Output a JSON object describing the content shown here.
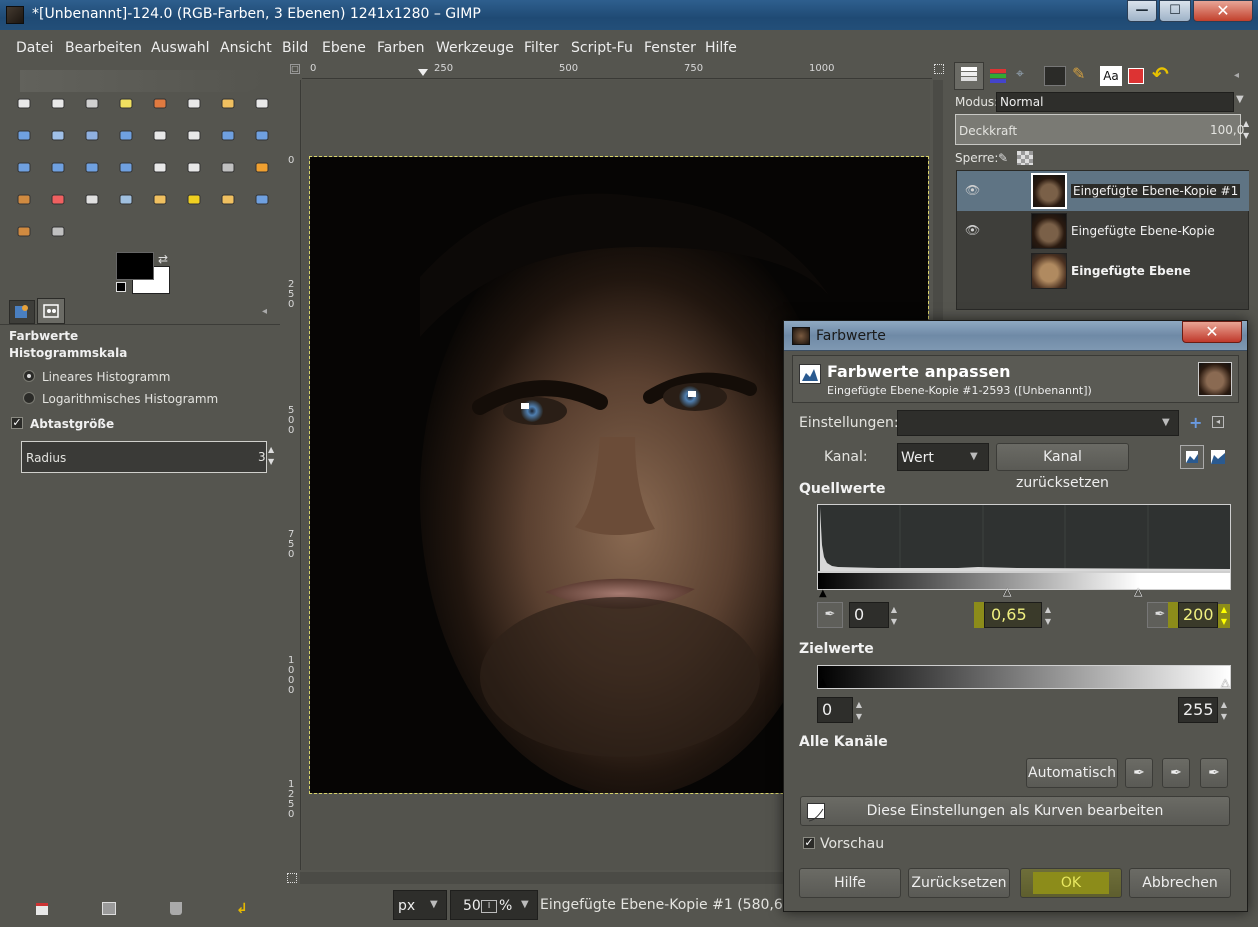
{
  "window": {
    "title": "*[Unbenannt]-124.0 (RGB-Farben, 3 Ebenen) 1241x1280 – GIMP",
    "min_label": "—",
    "max_label": "☐",
    "close_label": "✕"
  },
  "menubar": [
    "Datei",
    "Bearbeiten",
    "Auswahl",
    "Ansicht",
    "Bild",
    "Ebene",
    "Farben",
    "Werkzeuge",
    "Filter",
    "Script-Fu",
    "Fenster",
    "Hilfe"
  ],
  "tool_options": {
    "title": "Farbwerte",
    "histogram_label": "Histogrammskala",
    "linear": "Lineares Histogramm",
    "log": "Logarithmisches Histogramm",
    "sample_size": "Abtastgröße",
    "radius_label": "Radius",
    "radius_value": "3"
  },
  "rulers": {
    "top": [
      "0",
      "250",
      "500",
      "750",
      "1000"
    ],
    "left": [
      "0",
      "2\n5\n0",
      "5\n0\n0",
      "7\n5\n0",
      "1\n0\n0\n0",
      "1\n2\n5\n0"
    ]
  },
  "statusbar": {
    "unit": "px",
    "zoom": "50",
    "zoom_suffix": "%",
    "info": "Eingefügte Ebene-Kopie #1 (580,6 M"
  },
  "layers_dock": {
    "mode_label": "Modus:",
    "mode_value": "Normal",
    "opacity_label": "Deckkraft",
    "opacity_value": "100,0",
    "lock_label": "Sperre:",
    "layers": [
      {
        "name": "Eingefügte Ebene-Kopie #1",
        "visible": true,
        "selected": true
      },
      {
        "name": "Eingefügte Ebene-Kopie",
        "visible": true,
        "selected": false
      },
      {
        "name": "Eingefügte Ebene",
        "visible": false,
        "selected": false
      }
    ]
  },
  "dialog": {
    "title": "Farbwerte",
    "header": "Farbwerte anpassen",
    "subheader": "Eingefügte Ebene-Kopie #1-2593 ([Unbenannt])",
    "settings_label": "Einstellungen:",
    "channel_label": "Kanal:",
    "channel_value": "Wert",
    "reset_channel": "Kanal zurücksetzen",
    "source_title": "Quellwerte",
    "input_low": "0",
    "gamma": "0,65",
    "input_high": "200",
    "target_title": "Zielwerte",
    "output_low": "0",
    "output_high": "255",
    "all_channels": "Alle Kanäle",
    "auto": "Automatisch",
    "edit_curves": "Diese Einstellungen als Kurven bearbeiten",
    "preview": "Vorschau",
    "help": "Hilfe",
    "reset": "Zurücksetzen",
    "ok": "OK",
    "cancel": "Abbrechen"
  },
  "colors": {
    "accent": "#8c8c1a",
    "titlebar": "#2e5f8e",
    "panel": "#55554f"
  }
}
